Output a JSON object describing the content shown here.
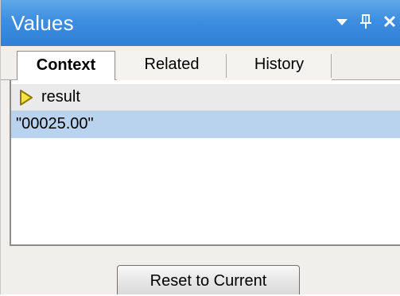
{
  "panel": {
    "title": "Values",
    "buttons": {
      "dropdown_icon": "chevron-down-icon",
      "pin_icon": "pin-icon",
      "close_icon": "close-icon"
    }
  },
  "tabs": [
    {
      "label": "Context",
      "active": true
    },
    {
      "label": "Related",
      "active": false
    },
    {
      "label": "History",
      "active": false
    }
  ],
  "values_list": {
    "header": {
      "icon": "play-arrow-icon",
      "label": "result"
    },
    "selected_value": "\"00025.00\""
  },
  "footer": {
    "reset_label": "Reset to Current"
  },
  "colors": {
    "titlebar": "#3d8ee0",
    "selected_row": "#b9d3ee",
    "header_row": "#eaeaea",
    "arrow_fill": "#f5e33b",
    "arrow_stroke": "#8a7a00"
  }
}
